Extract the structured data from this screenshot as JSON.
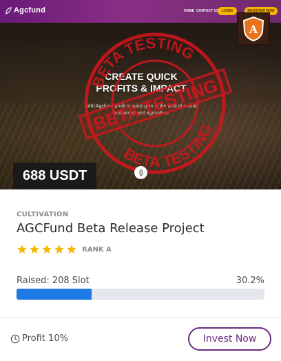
{
  "site": {
    "logo_text": "Agcfund",
    "nav": {
      "home": "HOME",
      "contact": "CONTACT US",
      "login": "LOGIN",
      "register": "REGISTER NOW"
    },
    "nav_color": "#7a2580",
    "button_color": "#f4b400",
    "badge_letter": "A"
  },
  "hero": {
    "title_line1": "CREATE QUICK",
    "title_line2": "PROFITS & IMPACT",
    "subtitle_line1": "With Agcfund profit is quick gain in the field of animal",
    "subtitle_line2": "husbandry and agriculture",
    "stamp_top": "BETA TESTING",
    "stamp_middle": "BETA TESTING",
    "stamp_bottom": "BETA TESTING",
    "stamp_color": "#d4161e",
    "price": "688 USDT"
  },
  "card": {
    "category": "CULTIVATION",
    "title": "AGCFund Beta Release Project",
    "stars": 5,
    "star_color": "#f5b800",
    "rank": "RANK A",
    "raised_label": "Raised: 208 Slot",
    "raised_percent": "30.2%",
    "progress_percent": 30.2,
    "progress_color": "#1e7ae6",
    "profit_label": "Profit 10%",
    "invest_button": "Invest Now",
    "accent_color": "#6b2a80"
  }
}
